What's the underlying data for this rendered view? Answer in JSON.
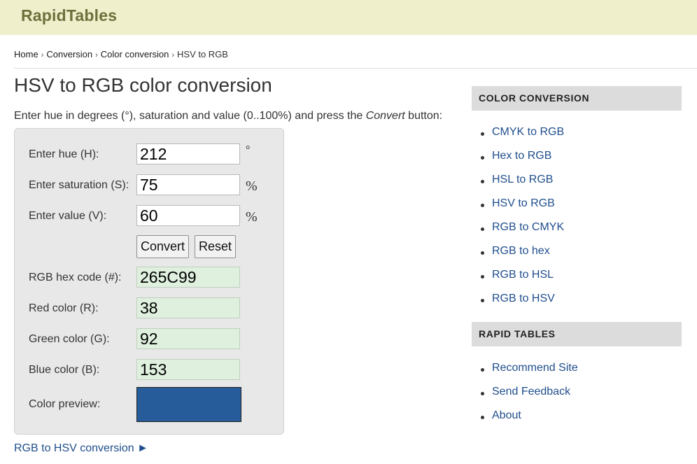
{
  "header": {
    "logo": "RapidTables"
  },
  "breadcrumb": {
    "items": [
      "Home",
      "Conversion",
      "Color conversion",
      "HSV to RGB"
    ],
    "separator": "›"
  },
  "main": {
    "title": "HSV to RGB color conversion",
    "intro_before": "Enter hue in degrees (°), saturation and value (0..100%) and press the ",
    "intro_em": "Convert",
    "intro_after": " button:"
  },
  "form": {
    "hue_label": "Enter hue (H):",
    "hue_value": "212",
    "hue_unit": "°",
    "sat_label": "Enter saturation (S):",
    "sat_value": "75",
    "sat_unit": "%",
    "val_label": "Enter value (V):",
    "val_value": "60",
    "val_unit": "%",
    "convert_label": "Convert",
    "reset_label": "Reset",
    "hex_label": "RGB hex code (#):",
    "hex_value": "265C99",
    "red_label": "Red color (R):",
    "red_value": "38",
    "green_label": "Green color (G):",
    "green_value": "92",
    "blue_label": "Blue color (B):",
    "blue_value": "153",
    "preview_label": "Color preview:",
    "preview_color": "#265c99"
  },
  "bottom_link": "RGB to HSV conversion ►",
  "sidebar": {
    "color_conversion_title": "COLOR CONVERSION",
    "color_conversion_items": [
      "CMYK to RGB",
      "Hex to RGB",
      "HSL to RGB",
      "HSV to RGB",
      "RGB to CMYK",
      "RGB to hex",
      "RGB to HSL",
      "RGB to HSV"
    ],
    "rapid_tables_title": "RAPID TABLES",
    "rapid_tables_items": [
      "Recommend Site",
      "Send Feedback",
      "About"
    ]
  },
  "colors": {
    "topbar": "#efefcc",
    "logo": "#6f6f3c",
    "link": "#1f4e8c",
    "output_bg": "#dff0df"
  }
}
